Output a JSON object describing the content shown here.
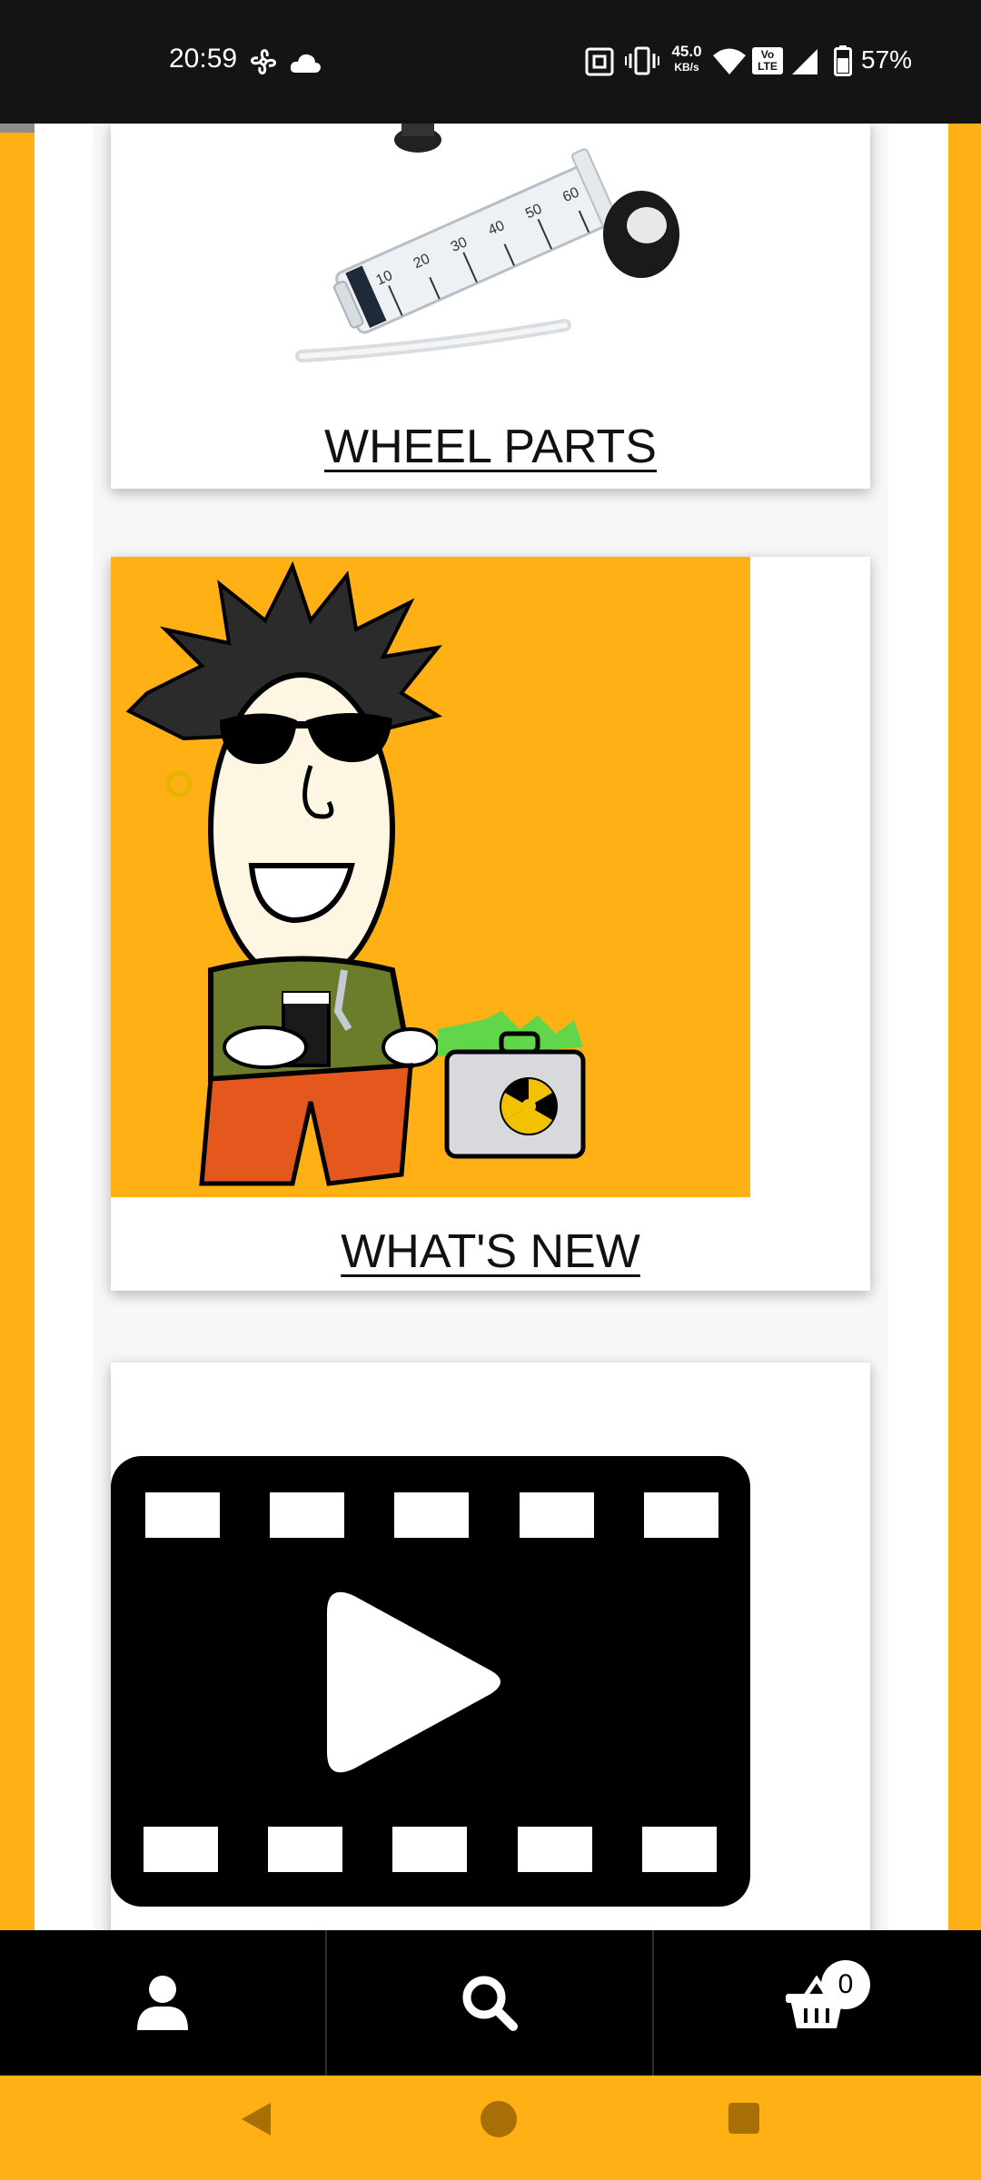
{
  "status_bar": {
    "time": "20:59",
    "network_speed_value": "45.0",
    "network_speed_unit": "KB/s",
    "volte_label_top": "Vo",
    "volte_label_bottom": "LTE",
    "battery_text": "57%"
  },
  "cards": [
    {
      "title": "WHEEL PARTS"
    },
    {
      "title": "WHAT'S NEW"
    },
    {
      "title": ""
    }
  ],
  "bottom_nav": {
    "account_icon": "user-icon",
    "search_icon": "search-icon",
    "cart_icon": "basket-icon",
    "cart_count": "0"
  },
  "colors": {
    "accent": "#FFB014",
    "status_bar": "#141414",
    "nav_bar": "#000000"
  }
}
